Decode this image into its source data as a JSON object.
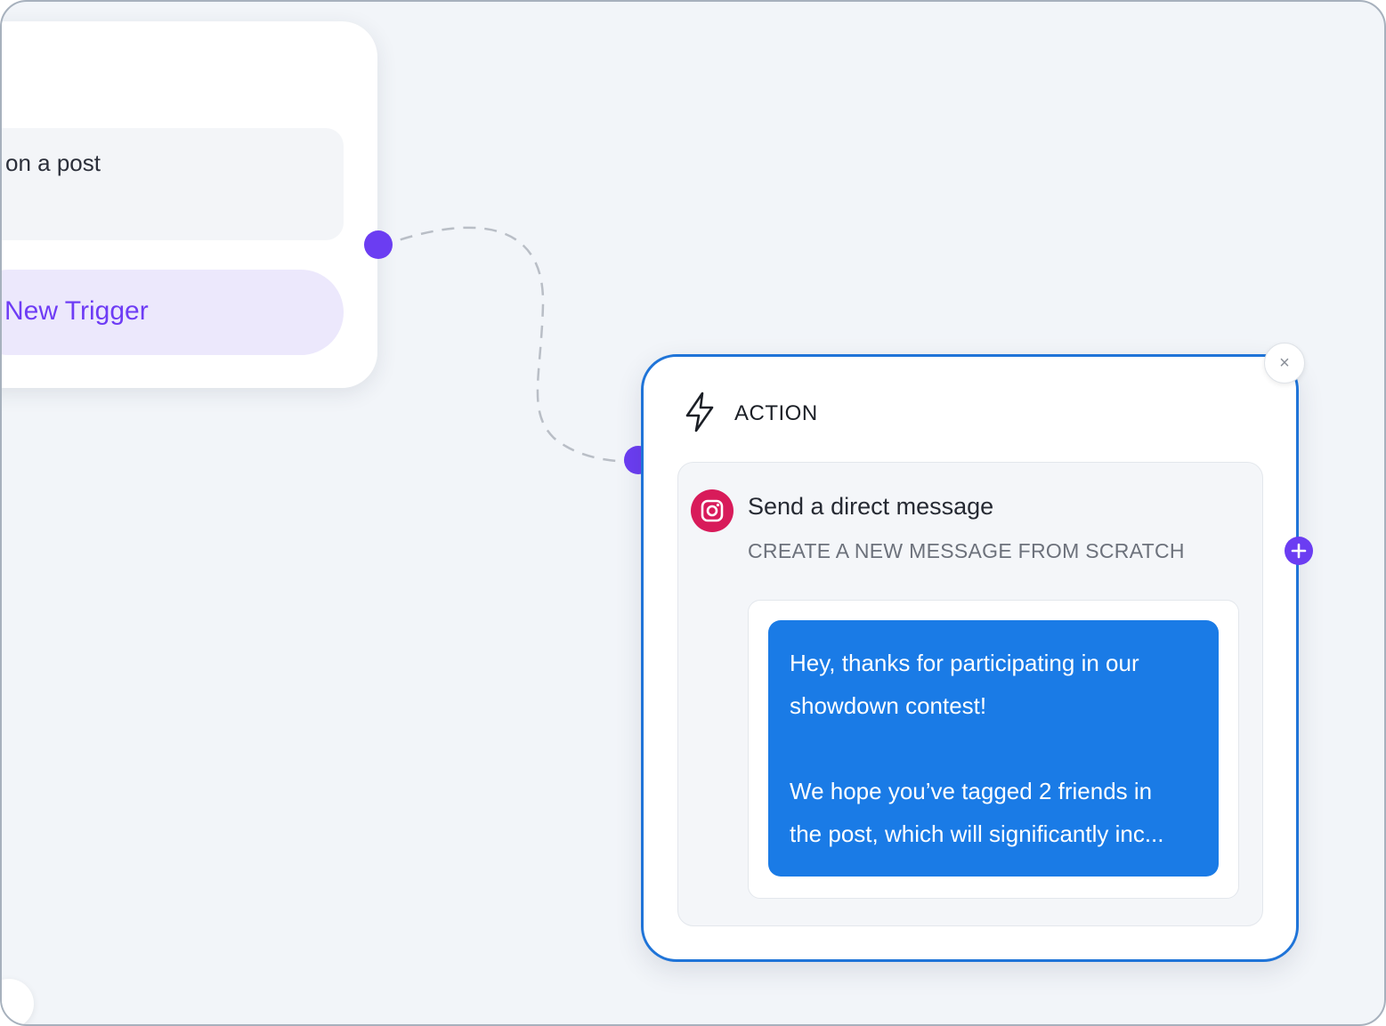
{
  "trigger_card": {
    "item_label": "on a post",
    "new_trigger_label": "New Trigger"
  },
  "action_card": {
    "header_label": "ACTION",
    "close_glyph": "×",
    "step": {
      "title": "Send a direct message",
      "subtitle": "CREATE A NEW MESSAGE FROM SCRATCH",
      "message_lines_1": [
        "Hey, thanks for participating in our",
        "showdown contest!"
      ],
      "message_lines_2": [
        "We hope you’ve tagged 2 friends in",
        "the post, which will significantly inc..."
      ]
    }
  },
  "icons": {
    "action": "lightning-bolt-icon",
    "platform": "instagram-icon",
    "close": "close-icon",
    "add": "plus-icon"
  },
  "colors": {
    "accent_purple": "#6b3df2",
    "action_border": "#1f74d8",
    "message_bubble": "#1a7be6",
    "instagram": "#d81b5a"
  }
}
